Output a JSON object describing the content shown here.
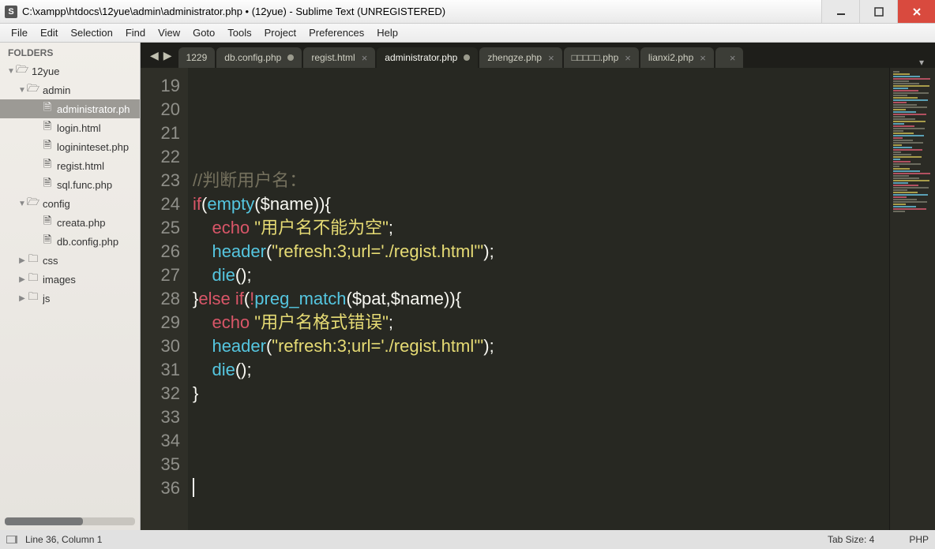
{
  "titlebar": {
    "title": "C:\\xampp\\htdocs\\12yue\\admin\\administrator.php • (12yue) - Sublime Text (UNREGISTERED)"
  },
  "menu": {
    "items": [
      "File",
      "Edit",
      "Selection",
      "Find",
      "View",
      "Goto",
      "Tools",
      "Project",
      "Preferences",
      "Help"
    ]
  },
  "sidebar": {
    "header": "FOLDERS",
    "tree": [
      {
        "depth": 0,
        "open": true,
        "icon": "folder",
        "label": "12yue"
      },
      {
        "depth": 1,
        "open": true,
        "icon": "folder",
        "label": "admin"
      },
      {
        "depth": 2,
        "icon": "file",
        "label": "administrator.ph",
        "selected": true
      },
      {
        "depth": 2,
        "icon": "file",
        "label": "login.html"
      },
      {
        "depth": 2,
        "icon": "file",
        "label": "logininteset.php"
      },
      {
        "depth": 2,
        "icon": "file",
        "label": "regist.html"
      },
      {
        "depth": 2,
        "icon": "file",
        "label": "sql.func.php"
      },
      {
        "depth": 1,
        "open": true,
        "icon": "folder",
        "label": "config"
      },
      {
        "depth": 2,
        "icon": "file",
        "label": "creata.php"
      },
      {
        "depth": 2,
        "icon": "file",
        "label": "db.config.php"
      },
      {
        "depth": 1,
        "open": false,
        "icon": "folder",
        "label": "css"
      },
      {
        "depth": 1,
        "open": false,
        "icon": "folder",
        "label": "images"
      },
      {
        "depth": 1,
        "open": false,
        "icon": "folder",
        "label": "js"
      }
    ]
  },
  "tabs": {
    "truncated": "1229",
    "items": [
      {
        "label": "db.config.php",
        "dirty": true
      },
      {
        "label": "regist.html",
        "close": true
      },
      {
        "label": "administrator.php",
        "dirty": true,
        "active": true
      },
      {
        "label": "zhengze.php",
        "close": true
      },
      {
        "label": "□□□□□.php",
        "close": true
      },
      {
        "label": "lianxi2.php",
        "close": true
      }
    ],
    "extra_close": "×"
  },
  "editor": {
    "first_line": 19,
    "last_line": 36,
    "lines": [
      [],
      [],
      [],
      [],
      [
        {
          "cls": "c-cmt",
          "t": "//判断用户名："
        }
      ],
      [
        {
          "cls": "c-kw",
          "t": "if"
        },
        {
          "cls": "c-punc",
          "t": "("
        },
        {
          "cls": "c-fn",
          "t": "empty"
        },
        {
          "cls": "c-punc",
          "t": "("
        },
        {
          "cls": "c-var",
          "t": "$name"
        },
        {
          "cls": "c-punc",
          "t": ")){"
        }
      ],
      [
        {
          "cls": "c-punc",
          "t": "    "
        },
        {
          "cls": "c-kw",
          "t": "echo"
        },
        {
          "cls": "c-punc",
          "t": " "
        },
        {
          "cls": "c-str",
          "t": "\"用户名不能为空\""
        },
        {
          "cls": "c-punc",
          "t": ";"
        }
      ],
      [
        {
          "cls": "c-punc",
          "t": "    "
        },
        {
          "cls": "c-fn",
          "t": "header"
        },
        {
          "cls": "c-punc",
          "t": "("
        },
        {
          "cls": "c-str",
          "t": "\"refresh:3;url='./regist.html'\""
        },
        {
          "cls": "c-punc",
          "t": ");"
        }
      ],
      [
        {
          "cls": "c-punc",
          "t": "    "
        },
        {
          "cls": "c-fn",
          "t": "die"
        },
        {
          "cls": "c-punc",
          "t": "();"
        }
      ],
      [
        {
          "cls": "c-punc",
          "t": "}"
        },
        {
          "cls": "c-kw",
          "t": "else if"
        },
        {
          "cls": "c-punc",
          "t": "("
        },
        {
          "cls": "c-op",
          "t": "!"
        },
        {
          "cls": "c-fn",
          "t": "preg_match"
        },
        {
          "cls": "c-punc",
          "t": "("
        },
        {
          "cls": "c-var",
          "t": "$pat"
        },
        {
          "cls": "c-punc",
          "t": ","
        },
        {
          "cls": "c-var",
          "t": "$name"
        },
        {
          "cls": "c-punc",
          "t": ")){"
        }
      ],
      [
        {
          "cls": "c-punc",
          "t": "    "
        },
        {
          "cls": "c-kw",
          "t": "echo"
        },
        {
          "cls": "c-punc",
          "t": " "
        },
        {
          "cls": "c-str",
          "t": "\"用户名格式错误\""
        },
        {
          "cls": "c-punc",
          "t": ";"
        }
      ],
      [
        {
          "cls": "c-punc",
          "t": "    "
        },
        {
          "cls": "c-fn",
          "t": "header"
        },
        {
          "cls": "c-punc",
          "t": "("
        },
        {
          "cls": "c-str",
          "t": "\"refresh:3;url='./regist.html'\""
        },
        {
          "cls": "c-punc",
          "t": ");"
        }
      ],
      [
        {
          "cls": "c-punc",
          "t": "    "
        },
        {
          "cls": "c-fn",
          "t": "die"
        },
        {
          "cls": "c-punc",
          "t": "();"
        }
      ],
      [
        {
          "cls": "c-punc",
          "t": "}"
        }
      ],
      [],
      [],
      [],
      [
        {
          "caret": true
        }
      ]
    ]
  },
  "statusbar": {
    "cursor": "Line 36, Column 1",
    "tabsize": "Tab Size: 4",
    "syntax": "PHP"
  }
}
